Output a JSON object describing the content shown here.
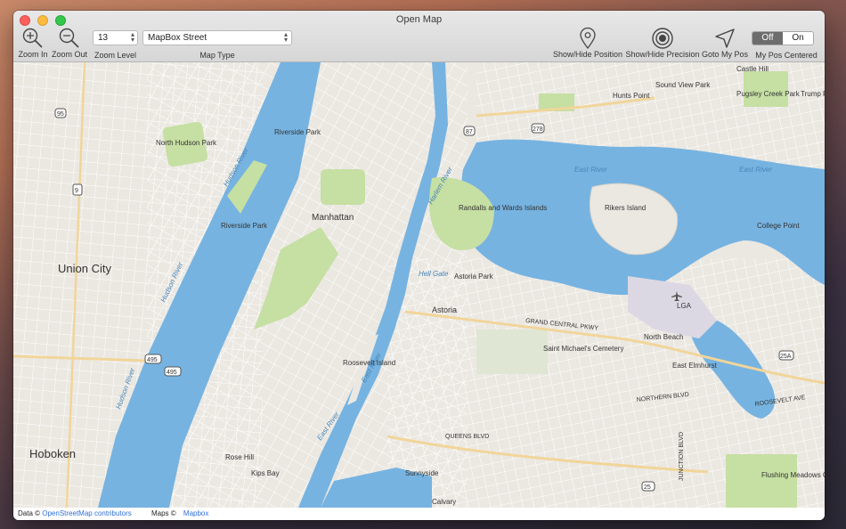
{
  "window": {
    "title": "Open Map"
  },
  "toolbar": {
    "zoom_in_label": "Zoom In",
    "zoom_out_label": "Zoom Out",
    "zoom_level_label": "Zoom Level",
    "zoom_level_value": "13",
    "map_type_label": "Map Type",
    "map_type_value": "MapBox Street",
    "show_hide_position_label": "Show/Hide Position",
    "show_hide_precision_label": "Show/Hide Precision",
    "goto_my_pos_label": "Goto My Pos",
    "my_pos_centered_label": "My Pos Centered",
    "segment_off": "Off",
    "segment_on": "On"
  },
  "map": {
    "colors": {
      "water": "#76b3e1",
      "land": "#ebe8e2",
      "park": "#c6dfa3",
      "road": "#ffffff",
      "highway": "#f1d59a"
    },
    "labels": {
      "union_city": "Union City",
      "hoboken": "Hoboken",
      "north_hudson_park": "North Hudson Park",
      "riverside_park": "Riverside Park",
      "riverside_park_2": "Riverside Park",
      "manhattan": "Manhattan",
      "hudson_river_1": "Hudson River",
      "hudson_river_2": "Hudson River",
      "hudson_river_3": "Hudson River",
      "east_river_1": "East River",
      "east_river_2": "East River",
      "east_river_3": "East River",
      "east_river_4": "East River",
      "harlem_river": "Harlem River",
      "hell_gate": "Hell Gate",
      "randalls": "Randalls and Wards Islands",
      "rikers": "Rikers Island",
      "astoria_park": "Astoria Park",
      "astoria": "Astoria",
      "roosevelt_island": "Roosevelt Island",
      "saint_michaels": "Saint Michael's Cemetery",
      "north_beach": "North Beach",
      "east_elmhurst": "East Elmhurst",
      "sunnyside": "Sunnyside",
      "kips_bay": "Kips Bay",
      "rose_hill": "Rose Hill",
      "calvary": "Calvary",
      "flushing_meadows": "Flushing Meadows Corona Park",
      "college_point": "College Point",
      "castle_hill": "Castle Hill",
      "sound_view_park": "Sound View Park",
      "hunts_point": "Hunts Point",
      "pugsley_creek": "Pugsley Creek Park",
      "trump_ferry": "Trump Ferry",
      "lga": "LGA",
      "grand_central_pkwy": "GRAND CENTRAL PKWY",
      "queens_blvd": "QUEENS BLVD",
      "northern_blvd": "NORTHERN BLVD",
      "roosevelt_ave": "ROOSEVELT AVE",
      "junction_blvd": "JUNCTION BLVD",
      "shield_495": "495",
      "shield_495b": "495",
      "shield_278": "278",
      "shield_87": "87",
      "shield_95": "95",
      "shield_25a": "25A",
      "shield_25": "25",
      "shield_9": "9"
    }
  },
  "footer": {
    "data_prefix": "Data ©",
    "data_link": "OpenStreetMap contributors",
    "maps_prefix": "Maps ©",
    "maps_link": "Mapbox"
  }
}
